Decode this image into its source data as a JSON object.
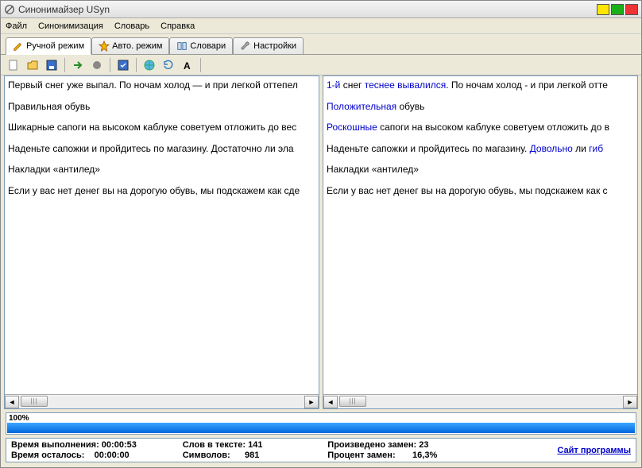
{
  "title": "Синонимайзер USyn",
  "menu": {
    "file": "Файл",
    "syn": "Синонимизация",
    "dict": "Словарь",
    "help": "Справка"
  },
  "tabs": {
    "manual": "Ручной режим",
    "auto": "Авто. режим",
    "dicts": "Словари",
    "settings": "Настройки"
  },
  "left": {
    "p1": "Первый снег уже выпал. По ночам холод — и при легкой оттепел",
    "p2": "Правильная обувь",
    "p3": "Шикарные сапоги на высоком каблуке советуем отложить до вес",
    "p4": "Наденьте сапожки и пройдитесь по магазину. Достаточно ли эла",
    "p5": "Накладки «антилед»",
    "p6": "Если у вас нет денег вы на дорогую обувь, мы подскажем как сде"
  },
  "right": {
    "p1a": "1-й",
    "p1b": " снег ",
    "p1c": "теснее вывалился",
    "p1d": ". По ночам холод - и при легкой отте",
    "p2a": "Положительная",
    "p2b": " обувь",
    "p3a": "Роскошные",
    "p3b": " сапоги на высоком каблуке советуем отложить до в",
    "p4a": "Наденьте сапожки и пройдитесь по магазину. ",
    "p4b": "Довольно",
    "p4c": " ли ",
    "p4d": "гиб",
    "p5": "Накладки «антилед»",
    "p6": "Если у вас нет денег вы на дорогую обувь, мы подскажем как с"
  },
  "progress": {
    "label": "100%"
  },
  "status": {
    "l_runtime": "Время выполнения:",
    "v_runtime": "00:00:53",
    "l_remain": "Время осталось:",
    "v_remain": "00:00:00",
    "l_words": "Слов в тексте:",
    "v_words": "141",
    "l_chars": "Символов:",
    "v_chars": "981",
    "l_repl": "Произведено замен:",
    "v_repl": "23",
    "l_pct": "Процент замен:",
    "v_pct": "16,3%",
    "site": "Сайт программы"
  }
}
